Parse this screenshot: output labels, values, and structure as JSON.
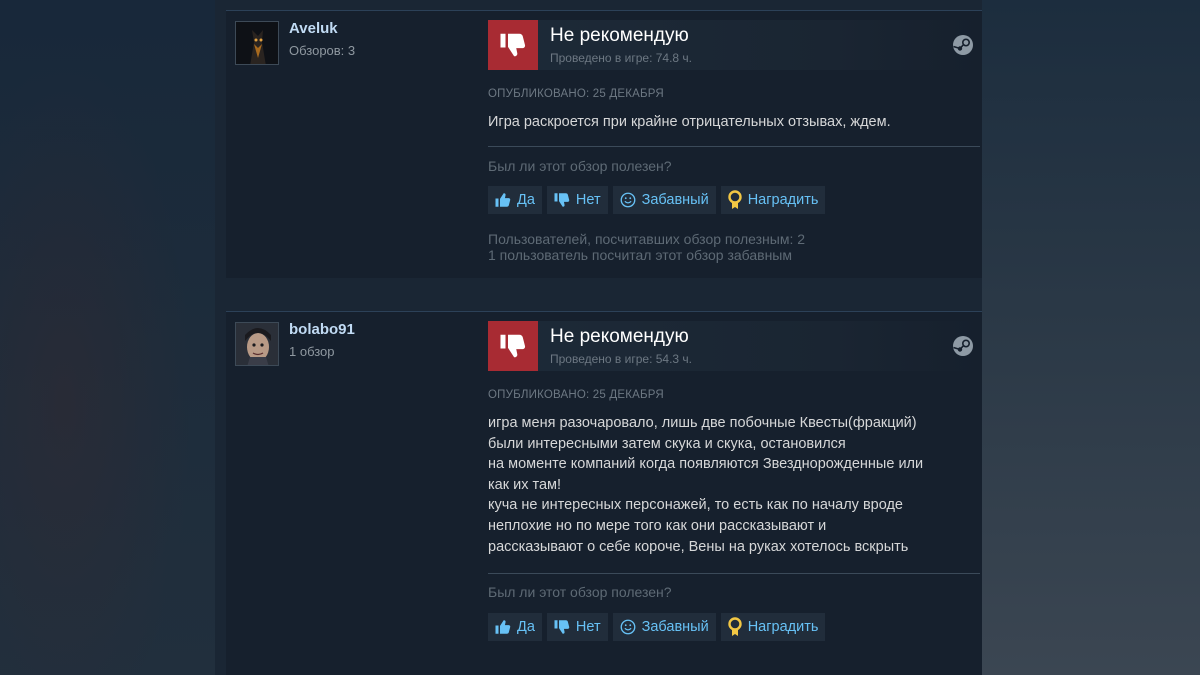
{
  "reviews": [
    {
      "username": "Aveluk",
      "review_count": "Обзоров: 3",
      "verdict": "Не рекомендую",
      "hours": "Проведено в игре: 74.8 ч.",
      "posted": "ОПУБЛИКОВАНО: 25 ДЕКАБРЯ",
      "body": [
        "Игра раскроется при крайне отрицательных отзывах, ждем."
      ],
      "helpful_question": "Был ли этот обзор полезен?",
      "buttons": {
        "yes": "Да",
        "no": "Нет",
        "funny": "Забавный",
        "award": "Наградить"
      },
      "stats": [
        "Пользователей, посчитавших обзор полезным: 2",
        "1 пользователь посчитал этот обзор забавным"
      ]
    },
    {
      "username": "bolabo91",
      "review_count": "1 обзор",
      "verdict": "Не рекомендую",
      "hours": "Проведено в игре: 54.3 ч.",
      "posted": "ОПУБЛИКОВАНО: 25 ДЕКАБРЯ",
      "body": [
        "игра меня разочаровало, лишь две побочные Квесты(фракций)",
        "были интересными затем скука и скука, остановился",
        "на моменте компаний когда появляются Звезднорожденные или",
        "как их там!",
        "куча не интересных персонажей, то есть как по началу вроде",
        "неплохие но по мере того как они рассказывают и",
        "рассказывают о себе короче, Вены на руках хотелось вскрыть"
      ],
      "helpful_question": "Был ли этот обзор полезен?",
      "buttons": {
        "yes": "Да",
        "no": "Нет",
        "funny": "Забавный",
        "award": "Наградить"
      }
    }
  ],
  "icons": {
    "verdict": "thumbs-down-icon",
    "platform": "steam-icon",
    "yes": "thumbs-up-icon",
    "no": "thumbs-down-icon",
    "funny": "smiley-icon",
    "award": "award-medal-icon"
  },
  "colors": {
    "negative": "#a82b33",
    "link": "#67c1f5",
    "username": "#c1dbf4",
    "award": "#f2c744"
  }
}
